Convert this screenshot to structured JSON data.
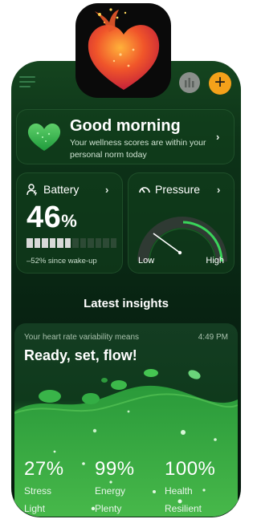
{
  "greeting": {
    "title": "Good morning",
    "subtitle": "Your wellness scores are within your personal norm today"
  },
  "battery": {
    "label": "Battery",
    "value": "46",
    "unit": "%",
    "level_fraction": 0.46,
    "change_text": "–52% since wake-up"
  },
  "pressure": {
    "label": "Pressure",
    "low_label": "Low",
    "high_label": "High"
  },
  "insights": {
    "heading": "Latest insights",
    "card": {
      "subtitle": "Your heart rate variability means",
      "time": "4:49 PM",
      "title": "Ready, set, flow!",
      "stats": [
        {
          "value": "27%",
          "label": "Stress",
          "sub": "Light"
        },
        {
          "value": "99%",
          "label": "Energy",
          "sub": "Plenty"
        },
        {
          "value": "100%",
          "label": "Health",
          "sub": "Resilient"
        }
      ]
    }
  },
  "icons": {
    "menu": "menu-icon",
    "chart": "bar-chart-icon",
    "add": "plus-icon",
    "battery": "person-battery-icon",
    "pressure": "gauge-icon",
    "chevron": "chevron-right-icon"
  },
  "colors": {
    "accent_orange": "#f4a11a",
    "background_green": "#0d3318",
    "bright_green": "#3ea63e"
  }
}
